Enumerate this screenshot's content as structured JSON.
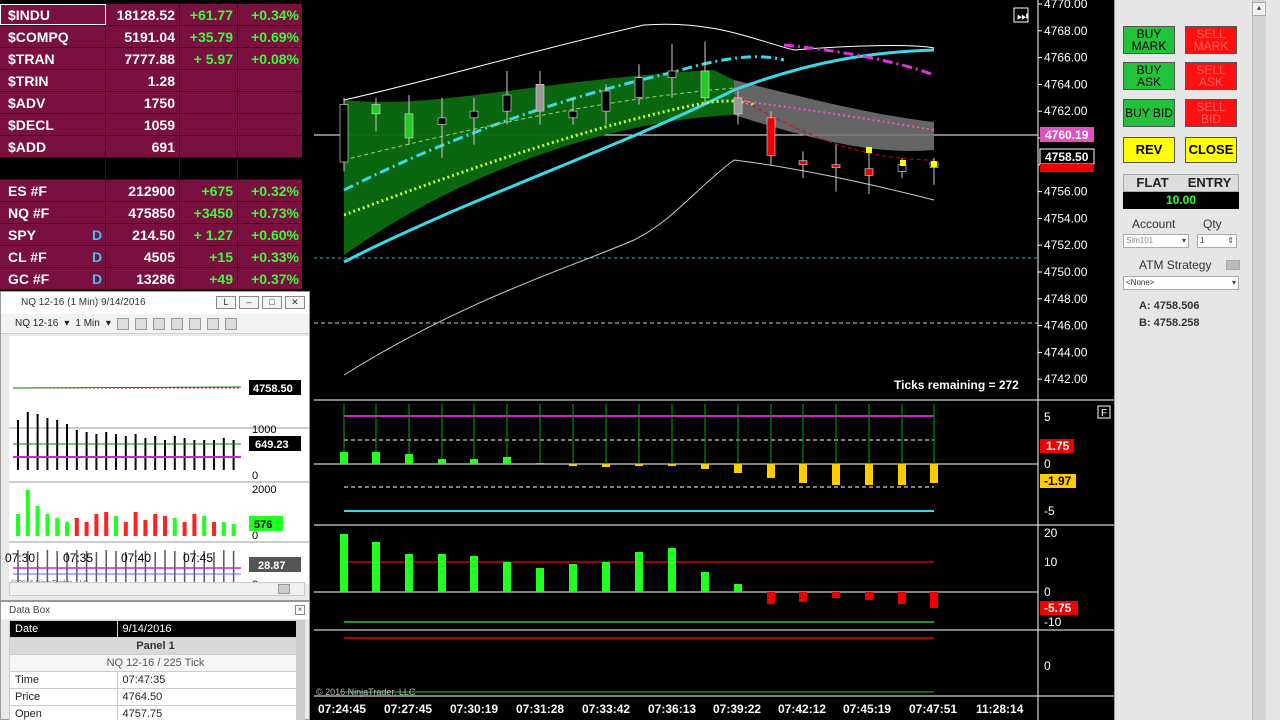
{
  "market_analyzer": {
    "rows": [
      {
        "symbol": "$INDU",
        "last": "18128.52",
        "change": "+61.77",
        "pct": "+0.34%",
        "style": "maroon",
        "d": ""
      },
      {
        "symbol": "$COMPQ",
        "last": "5191.04",
        "change": "+35.79",
        "pct": "+0.69%",
        "style": "maroon",
        "d": ""
      },
      {
        "symbol": "$TRAN",
        "last": "7777.88",
        "change": "+ 5.97",
        "pct": "+0.08%",
        "style": "maroon",
        "d": ""
      },
      {
        "symbol": "$TRIN",
        "last": "1.28",
        "change": "",
        "pct": "",
        "style": "maroon",
        "d": ""
      },
      {
        "symbol": "$ADV",
        "last": "1750",
        "change": "",
        "pct": "",
        "style": "maroon",
        "d": ""
      },
      {
        "symbol": "$DECL",
        "last": "1059",
        "change": "",
        "pct": "",
        "style": "maroon",
        "d": ""
      },
      {
        "symbol": "$ADD",
        "last": "691",
        "change": "",
        "pct": "",
        "style": "maroon",
        "d": ""
      },
      {
        "symbol": "",
        "last": "",
        "change": "",
        "pct": "",
        "style": "dark",
        "d": ""
      },
      {
        "symbol": "ES #F",
        "last": "212900",
        "change": "+675",
        "pct": "+0.32%",
        "style": "maroon",
        "d": ""
      },
      {
        "symbol": "NQ #F",
        "last": "475850",
        "change": "+3450",
        "pct": "+0.73%",
        "style": "maroon",
        "d": ""
      },
      {
        "symbol": "SPY",
        "last": "214.50",
        "change": "+ 1.27",
        "pct": "+0.60%",
        "style": "maroon",
        "d": "D"
      },
      {
        "symbol": "CL #F",
        "last": "4505",
        "change": "+15",
        "pct": "+0.33%",
        "style": "maroon",
        "d": "D"
      },
      {
        "symbol": "GC #F",
        "last": "13286",
        "change": "+49",
        "pct": "+0.37%",
        "style": "maroon",
        "d": "D"
      }
    ]
  },
  "mini_chart": {
    "title": "NQ 12-16 (1 Min)  9/14/2016",
    "instrument": "NQ 12-16",
    "interval": "1 Min",
    "price_tag": "4758.50",
    "vol_axis": [
      "1000",
      "0"
    ],
    "vol_tag": "649.23",
    "delta_axis": [
      "2000",
      "0"
    ],
    "delta_tag": "576",
    "ind_axis": [
      "0"
    ],
    "ind_tag": "28.87",
    "times": [
      "07:30",
      "07:35",
      "07:40",
      "07:45"
    ],
    "copyright": "© 2016 NinjaTrader, LLC",
    "win_buttons": [
      "L",
      "–",
      "□",
      "✕"
    ]
  },
  "data_box": {
    "title": "Data Box",
    "date_label": "Date",
    "date_value": "9/14/2016",
    "panel": "Panel 1",
    "series": "NQ 12-16 / 225 Tick",
    "rows": [
      {
        "label": "Time",
        "value": "07:47:35"
      },
      {
        "label": "Price",
        "value": "4764.50"
      },
      {
        "label": "Open",
        "value": "4757.75"
      }
    ]
  },
  "main_chart": {
    "price_axis": [
      "4770.00",
      "4768.00",
      "4766.00",
      "4764.00",
      "4762.00",
      "4760.00",
      "4758.00",
      "4756.00",
      "4754.00",
      "4752.00",
      "4750.00",
      "4748.00",
      "4746.00",
      "4744.00",
      "4742.00"
    ],
    "tag_pink": "4760.19",
    "tag_last": "4758.50",
    "ticks_remaining": "Ticks remaining = 272",
    "p2_axis": [
      "5",
      "0",
      "-5"
    ],
    "p2_tag_red": "1.75",
    "p2_tag_yellow": "-1.97",
    "p3_axis": [
      "20",
      "10",
      "0",
      "-10",
      "0"
    ],
    "p3_tag": "-5.75",
    "f_label": "F",
    "times": [
      "07:24:45",
      "07:27:45",
      "07:30:19",
      "07:31:28",
      "07:33:42",
      "07:36:13",
      "07:39:22",
      "07:42:12",
      "07:45:19",
      "07:47:51",
      "11:28:14"
    ],
    "copyright": "© 2016 NinjaTrader, LLC"
  },
  "chart_trader": {
    "buy_mark": "BUY MARK",
    "sell_mark": "SELL MARK",
    "buy_ask": "BUY ASK",
    "sell_ask": "SELL ASK",
    "buy_bid": "BUY BID",
    "sell_bid": "SELL BID",
    "rev": "REV",
    "close": "CLOSE",
    "flat": "FLAT",
    "entry": "ENTRY",
    "position": "10.00",
    "account_label": "Account",
    "qty_label": "Qty",
    "account_value": "Sim101",
    "qty_value": "1",
    "atm_label": "ATM Strategy",
    "atm_value": "<None>",
    "ask": "A: 4758.506",
    "bid": "B: 4758.258"
  },
  "colors": {
    "maroon": "#7a103f",
    "green": "#37ff37",
    "cyan": "#3ad8e8",
    "magenta": "#e030e0",
    "yellow": "#ffe000"
  }
}
